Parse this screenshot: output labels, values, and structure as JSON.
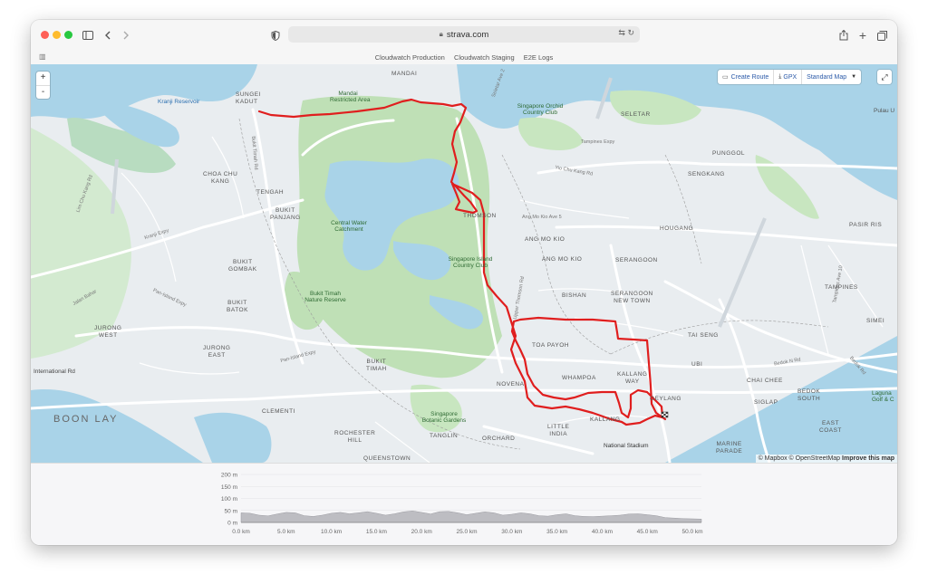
{
  "browser": {
    "url": "strava.com",
    "bookmarks": [
      "Cloudwatch Production",
      "Cloudwatch Staging",
      "E2E Logs"
    ]
  },
  "map": {
    "zoom_in": "+",
    "zoom_out": "-",
    "controls": {
      "create_route": "Create Route",
      "gpx": "GPX",
      "style": "Standard Map"
    },
    "attribution": {
      "mapbox": "© Mapbox",
      "osm": "© OpenStreetMap",
      "improve": "Improve this map"
    },
    "labels": {
      "mandai": "MANDAI",
      "mandai_restricted_1": "Mandai",
      "mandai_restricted_2": "Restricted Area",
      "sungei_kadut_1": "SUNGEI",
      "sungei_kadut_2": "KADUT",
      "kranji_reserve": "Kranji Reservoir",
      "sg_orchid_1": "Singapore Orchid",
      "sg_orchid_2": "Country Club",
      "seletar": "SELETAR",
      "pulau": "Pulau U",
      "tampines_expy": "Tampines Expy",
      "yio_chu_kang": "Yio Chu Kang Rd",
      "sengkang": "SENGKANG",
      "punggol": "PUNGGOL",
      "choa_chu_kang_1": "CHOA CHU",
      "choa_chu_kang_2": "KANG",
      "tengah": "TENGAH",
      "bukit_panjang_1": "BUKIT",
      "bukit_panjang_2": "PANJANG",
      "central_water_1": "Central Water",
      "central_water_2": "Catchment",
      "thomson": "THOMSON",
      "ang_mo_kio_ave": "Ang Mo Kio Ave 5",
      "ang_mo_kio_1": "ANG MO KIO",
      "ang_mo_kio_2": "ANG MO KIO",
      "hougang": "HOUGANG",
      "pasir_ris": "PASIR RIS",
      "tampines_ave": "Tampines Ave 10",
      "tampines": "TAMPINES",
      "lim_chu_kang": "Lim Chu Kang Rd",
      "kranji_expy": "Kranji Expy",
      "bukit_gombak_1": "BUKIT",
      "bukit_gombak_2": "GOMBAK",
      "sg_island_1": "Singapore Island",
      "sg_island_2": "Country Club",
      "serangoon": "SERANGOON",
      "serangoon_nt_1": "SERANGOON",
      "serangoon_nt_2": "NEW TOWN",
      "bishan": "BISHAN",
      "jalan_bahar": "Jalan Bahar",
      "pan_island_expy": "Pan-Island Expy",
      "bukit_batok_1": "BUKIT",
      "bukit_batok_2": "BATOK",
      "bukit_timah_reserve_1": "Bukit Timah",
      "bukit_timah_reserve_2": "Nature Reserve",
      "jurong_west_1": "JURONG",
      "jurong_west_2": "WEST",
      "jurong_east_1": "JURONG",
      "jurong_east_2": "EAST",
      "toa_payoh": "TOA PAYOH",
      "tai_seng": "TAI SENG",
      "simei": "SIMEI",
      "pan_island_expy_2": "Pan-Island Expy",
      "bukit_timah_1": "BUKIT",
      "bukit_timah_2": "TIMAH",
      "whampoa": "WHAMPOA",
      "kallang_way_1": "KALLANG",
      "kallang_way_2": "WAY",
      "ubi": "UBI",
      "bedok_n_rd": "Bedok N Rd",
      "chai_chee": "CHAI CHEE",
      "international_rd": "International Rd",
      "novena": "NOVENA",
      "geylang": "GEYLANG",
      "siglap": "SIGLAP",
      "bedok_south_1": "BEDOK",
      "bedok_south_2": "SOUTH",
      "laguna_1": "Laguna",
      "laguna_2": "Golf & C",
      "boon_lay": "BOON LAY",
      "clementi": "CLEMENTI",
      "sg_botanic_1": "Singapore",
      "sg_botanic_2": "Botanic Gardens",
      "little_india_1": "LITTLE",
      "little_india_2": "INDIA",
      "kallang": "KALLANG",
      "rochester_1": "ROCHESTER",
      "rochester_2": "HILL",
      "tanglin": "TANGLIN",
      "orchard": "ORCHARD",
      "national_stadium": "National Stadium",
      "marine_parade_1": "MARINE",
      "marine_parade_2": "PARADE",
      "east_coast_1": "EAST",
      "east_coast_2": "COAST",
      "queenstown": "QUEENSTOWN",
      "upper_thomson": "Upper Thomson Rd",
      "bukit_timah_rd": "Bukit Timah Rd",
      "seletar_ave": "Seletar Ave 2",
      "bedok_rd": "Bedok Rd"
    }
  },
  "elevation": {
    "y_ticks": [
      "200 m",
      "150 m",
      "100 m",
      "50 m",
      "0 m"
    ],
    "x_ticks": [
      "0.0 km",
      "5.0 km",
      "10.0 km",
      "15.0 km",
      "20.0 km",
      "25.0 km",
      "30.0 km",
      "35.0 km",
      "40.0 km",
      "45.0 km",
      "50.0 km"
    ]
  },
  "chart_data": {
    "type": "area",
    "title": "",
    "xlabel": "",
    "ylabel": "",
    "ylim": [
      0,
      200
    ],
    "xlim": [
      0,
      51
    ],
    "x_unit": "km",
    "y_unit": "m",
    "x": [
      0,
      1,
      2,
      3,
      4,
      5,
      6,
      7,
      8,
      9,
      10,
      11,
      12,
      13,
      14,
      15,
      16,
      17,
      18,
      19,
      20,
      21,
      22,
      23,
      24,
      25,
      26,
      27,
      28,
      29,
      30,
      31,
      32,
      33,
      34,
      35,
      36,
      37,
      38,
      39,
      40,
      41,
      42,
      43,
      44,
      45,
      46,
      47,
      48,
      49,
      50,
      51
    ],
    "y": [
      40,
      38,
      30,
      27,
      35,
      42,
      40,
      28,
      25,
      30,
      38,
      42,
      36,
      40,
      45,
      38,
      30,
      36,
      44,
      48,
      42,
      35,
      45,
      46,
      40,
      32,
      38,
      44,
      40,
      30,
      34,
      40,
      36,
      28,
      26,
      32,
      36,
      28,
      25,
      24,
      26,
      28,
      30,
      35,
      36,
      32,
      28,
      20,
      18,
      16,
      15,
      14
    ]
  },
  "colors": {
    "route": "#e01e1e",
    "water": "#a9d3e8",
    "park": "#c8e6c0",
    "accent": "#2b5aa8"
  }
}
